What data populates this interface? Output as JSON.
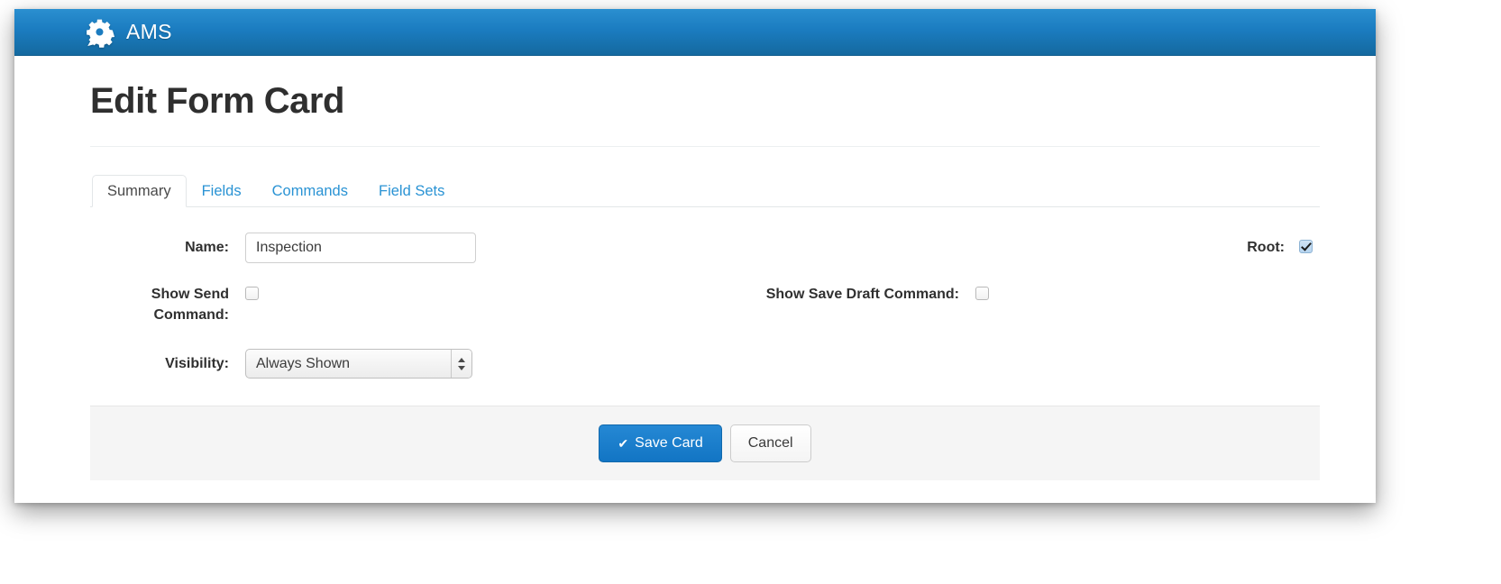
{
  "navbar": {
    "brand_label": "AMS",
    "brand_icon": "gear-icon",
    "background_color": "#1b7cc0"
  },
  "page": {
    "title": "Edit Form Card"
  },
  "tabs": [
    {
      "label": "Summary",
      "active": true
    },
    {
      "label": "Fields",
      "active": false
    },
    {
      "label": "Commands",
      "active": false
    },
    {
      "label": "Field Sets",
      "active": false
    }
  ],
  "form": {
    "name": {
      "label": "Name:",
      "value": "Inspection",
      "placeholder": ""
    },
    "root": {
      "label": "Root:",
      "checked": true
    },
    "show_send_command": {
      "label": "Show Send Command:",
      "checked": false
    },
    "show_save_draft_command": {
      "label": "Show Save Draft Command:",
      "checked": false
    },
    "visibility": {
      "label": "Visibility:",
      "value": "Always Shown"
    }
  },
  "footer": {
    "save_label": "Save Card",
    "save_icon": "check-icon",
    "cancel_label": "Cancel",
    "primary_color": "#1275c4"
  }
}
